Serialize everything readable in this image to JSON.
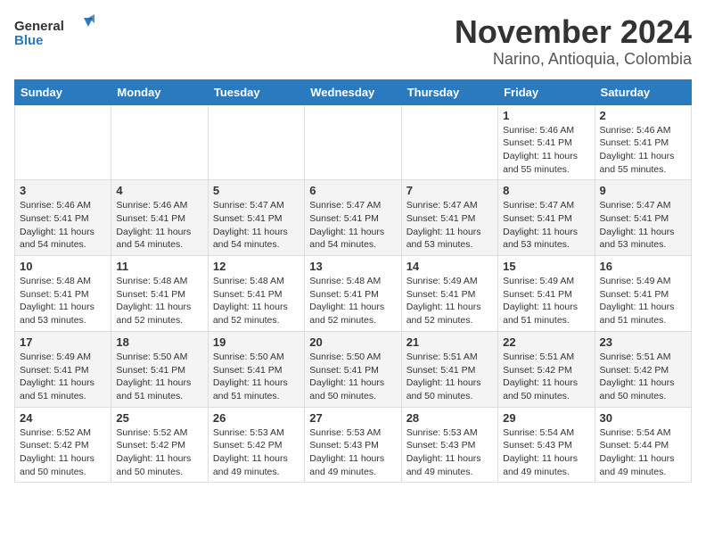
{
  "header": {
    "logo_line1": "General",
    "logo_line2": "Blue",
    "title": "November 2024",
    "subtitle": "Narino, Antioquia, Colombia"
  },
  "days": [
    "Sunday",
    "Monday",
    "Tuesday",
    "Wednesday",
    "Thursday",
    "Friday",
    "Saturday"
  ],
  "weeks": [
    [
      {
        "date": "",
        "info": ""
      },
      {
        "date": "",
        "info": ""
      },
      {
        "date": "",
        "info": ""
      },
      {
        "date": "",
        "info": ""
      },
      {
        "date": "",
        "info": ""
      },
      {
        "date": "1",
        "info": "Sunrise: 5:46 AM\nSunset: 5:41 PM\nDaylight: 11 hours and 55 minutes."
      },
      {
        "date": "2",
        "info": "Sunrise: 5:46 AM\nSunset: 5:41 PM\nDaylight: 11 hours and 55 minutes."
      }
    ],
    [
      {
        "date": "3",
        "info": "Sunrise: 5:46 AM\nSunset: 5:41 PM\nDaylight: 11 hours and 54 minutes."
      },
      {
        "date": "4",
        "info": "Sunrise: 5:46 AM\nSunset: 5:41 PM\nDaylight: 11 hours and 54 minutes."
      },
      {
        "date": "5",
        "info": "Sunrise: 5:47 AM\nSunset: 5:41 PM\nDaylight: 11 hours and 54 minutes."
      },
      {
        "date": "6",
        "info": "Sunrise: 5:47 AM\nSunset: 5:41 PM\nDaylight: 11 hours and 54 minutes."
      },
      {
        "date": "7",
        "info": "Sunrise: 5:47 AM\nSunset: 5:41 PM\nDaylight: 11 hours and 53 minutes."
      },
      {
        "date": "8",
        "info": "Sunrise: 5:47 AM\nSunset: 5:41 PM\nDaylight: 11 hours and 53 minutes."
      },
      {
        "date": "9",
        "info": "Sunrise: 5:47 AM\nSunset: 5:41 PM\nDaylight: 11 hours and 53 minutes."
      }
    ],
    [
      {
        "date": "10",
        "info": "Sunrise: 5:48 AM\nSunset: 5:41 PM\nDaylight: 11 hours and 53 minutes."
      },
      {
        "date": "11",
        "info": "Sunrise: 5:48 AM\nSunset: 5:41 PM\nDaylight: 11 hours and 52 minutes."
      },
      {
        "date": "12",
        "info": "Sunrise: 5:48 AM\nSunset: 5:41 PM\nDaylight: 11 hours and 52 minutes."
      },
      {
        "date": "13",
        "info": "Sunrise: 5:48 AM\nSunset: 5:41 PM\nDaylight: 11 hours and 52 minutes."
      },
      {
        "date": "14",
        "info": "Sunrise: 5:49 AM\nSunset: 5:41 PM\nDaylight: 11 hours and 52 minutes."
      },
      {
        "date": "15",
        "info": "Sunrise: 5:49 AM\nSunset: 5:41 PM\nDaylight: 11 hours and 51 minutes."
      },
      {
        "date": "16",
        "info": "Sunrise: 5:49 AM\nSunset: 5:41 PM\nDaylight: 11 hours and 51 minutes."
      }
    ],
    [
      {
        "date": "17",
        "info": "Sunrise: 5:49 AM\nSunset: 5:41 PM\nDaylight: 11 hours and 51 minutes."
      },
      {
        "date": "18",
        "info": "Sunrise: 5:50 AM\nSunset: 5:41 PM\nDaylight: 11 hours and 51 minutes."
      },
      {
        "date": "19",
        "info": "Sunrise: 5:50 AM\nSunset: 5:41 PM\nDaylight: 11 hours and 51 minutes."
      },
      {
        "date": "20",
        "info": "Sunrise: 5:50 AM\nSunset: 5:41 PM\nDaylight: 11 hours and 50 minutes."
      },
      {
        "date": "21",
        "info": "Sunrise: 5:51 AM\nSunset: 5:41 PM\nDaylight: 11 hours and 50 minutes."
      },
      {
        "date": "22",
        "info": "Sunrise: 5:51 AM\nSunset: 5:42 PM\nDaylight: 11 hours and 50 minutes."
      },
      {
        "date": "23",
        "info": "Sunrise: 5:51 AM\nSunset: 5:42 PM\nDaylight: 11 hours and 50 minutes."
      }
    ],
    [
      {
        "date": "24",
        "info": "Sunrise: 5:52 AM\nSunset: 5:42 PM\nDaylight: 11 hours and 50 minutes."
      },
      {
        "date": "25",
        "info": "Sunrise: 5:52 AM\nSunset: 5:42 PM\nDaylight: 11 hours and 50 minutes."
      },
      {
        "date": "26",
        "info": "Sunrise: 5:53 AM\nSunset: 5:42 PM\nDaylight: 11 hours and 49 minutes."
      },
      {
        "date": "27",
        "info": "Sunrise: 5:53 AM\nSunset: 5:43 PM\nDaylight: 11 hours and 49 minutes."
      },
      {
        "date": "28",
        "info": "Sunrise: 5:53 AM\nSunset: 5:43 PM\nDaylight: 11 hours and 49 minutes."
      },
      {
        "date": "29",
        "info": "Sunrise: 5:54 AM\nSunset: 5:43 PM\nDaylight: 11 hours and 49 minutes."
      },
      {
        "date": "30",
        "info": "Sunrise: 5:54 AM\nSunset: 5:44 PM\nDaylight: 11 hours and 49 minutes."
      }
    ]
  ]
}
